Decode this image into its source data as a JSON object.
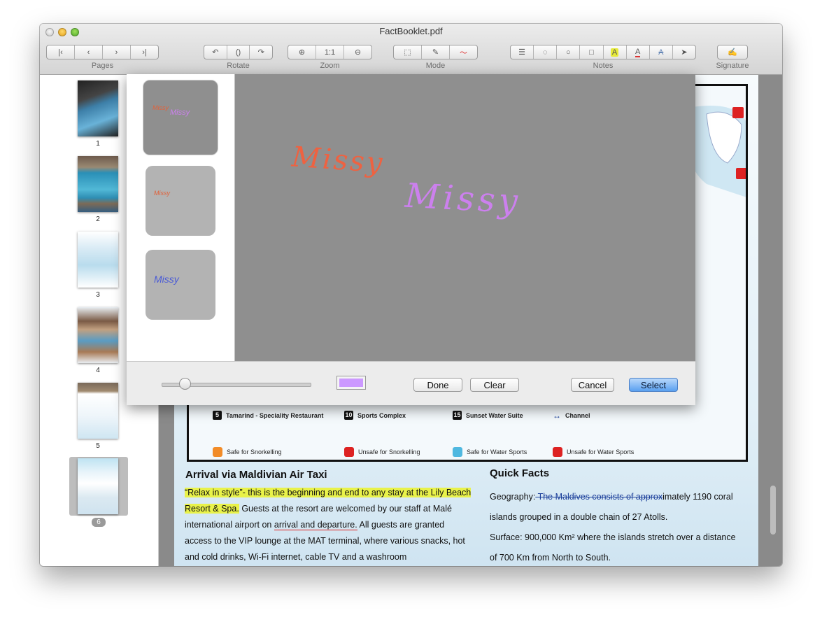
{
  "window": {
    "title": "FactBooklet.pdf"
  },
  "toolbar": {
    "groups": [
      {
        "label": "Pages",
        "buttons": [
          "first-page-icon",
          "previous-page-icon",
          "next-page-icon",
          "last-page-icon"
        ]
      },
      {
        "label": "Rotate",
        "buttons": [
          "rotate-left-icon",
          "flip-icon",
          "rotate-right-icon"
        ]
      },
      {
        "label": "Zoom",
        "buttons": [
          "zoom-in-icon",
          "actual-size",
          "zoom-out-icon"
        ],
        "actual_size_label": "1:1"
      },
      {
        "label": "Mode",
        "buttons": [
          "select-mode-icon",
          "pen-icon",
          "signature-pen-icon"
        ]
      },
      {
        "label": "Notes",
        "buttons": [
          "text-box-icon",
          "comment-icon",
          "circle-icon",
          "rectangle-icon",
          "highlight-icon",
          "underline-icon",
          "strikethrough-icon",
          "pointer-icon"
        ]
      },
      {
        "label": "Signature",
        "buttons": [
          "signature-icon"
        ]
      }
    ],
    "note_glyphs": {
      "highlight": "A",
      "underline": "A",
      "strike": "A"
    },
    "colors": {
      "highlight": "#e6ea39",
      "underline": "#d33",
      "strike": "#5b7fb2"
    }
  },
  "sidebar": {
    "pages": [
      {
        "number": "1"
      },
      {
        "number": "2"
      },
      {
        "number": "3"
      },
      {
        "number": "4"
      },
      {
        "number": "5"
      },
      {
        "number": "6",
        "selected": true
      }
    ]
  },
  "signature_panel": {
    "signatures": [
      {
        "text": "Missy",
        "color": "#e0623b",
        "second_text": "Missy",
        "second_color": "#cc80ee"
      },
      {
        "text": "Missy",
        "color": "#e0623b"
      },
      {
        "text": "Missy",
        "color": "#4a5bd6"
      }
    ],
    "canvas": [
      {
        "text": "Missy",
        "color": "#ee6241"
      },
      {
        "text": "Missy",
        "color": "#cc80ee"
      }
    ],
    "current_color": "#cc99ff",
    "slider_value": 0.05,
    "buttons": {
      "done": "Done",
      "clear": "Clear",
      "cancel": "Cancel",
      "select": "Select"
    }
  },
  "map_legend": {
    "rows": [
      [
        {
          "num": "5",
          "label": "Tamarind - Speciality Restaurant"
        },
        {
          "num": "10",
          "label": "Sports Complex"
        },
        {
          "num": "15",
          "label": "Sunset Water Suite"
        },
        {
          "icon": "↔",
          "label": "Channel"
        }
      ],
      [
        {
          "label": "Safe  for  Snorkelling",
          "color": "#f28c28"
        },
        {
          "label": "Unsafe  for  Snorkelling",
          "color": "#d22"
        },
        {
          "label": "Safe  for  Water Sports",
          "color": "#4fb8e0"
        },
        {
          "label": "Unsafe  for  Water Sports",
          "color": "#d22"
        }
      ]
    ]
  },
  "document": {
    "left_heading": "Arrival via Maldivian Air Taxi",
    "left_hl": "“Relax in style”- this is the beginning and end to any stay at the Lily Beach Resort & Spa.",
    "left_1": "Guests at the resort are welcomed by our staff at Malé international airport on",
    "left_ul": "arrival and departure.",
    "left_2": "All guests are granted access to the VIP lounge at the MAT terminal, where various snacks, hot and cold drinks, Wi-Fi internet, cable TV and a washroom",
    "right_heading": "Quick Facts",
    "geo_label": "Geography:",
    "geo_strike": " The Maldives consists of approx",
    "geo_rest": "imately 1190 coral islands grouped in a double chain of 27 Atolls.",
    "surface": "Surface: 900,000 Km² where the islands stretch over a distance of 700 Km from North to South."
  }
}
